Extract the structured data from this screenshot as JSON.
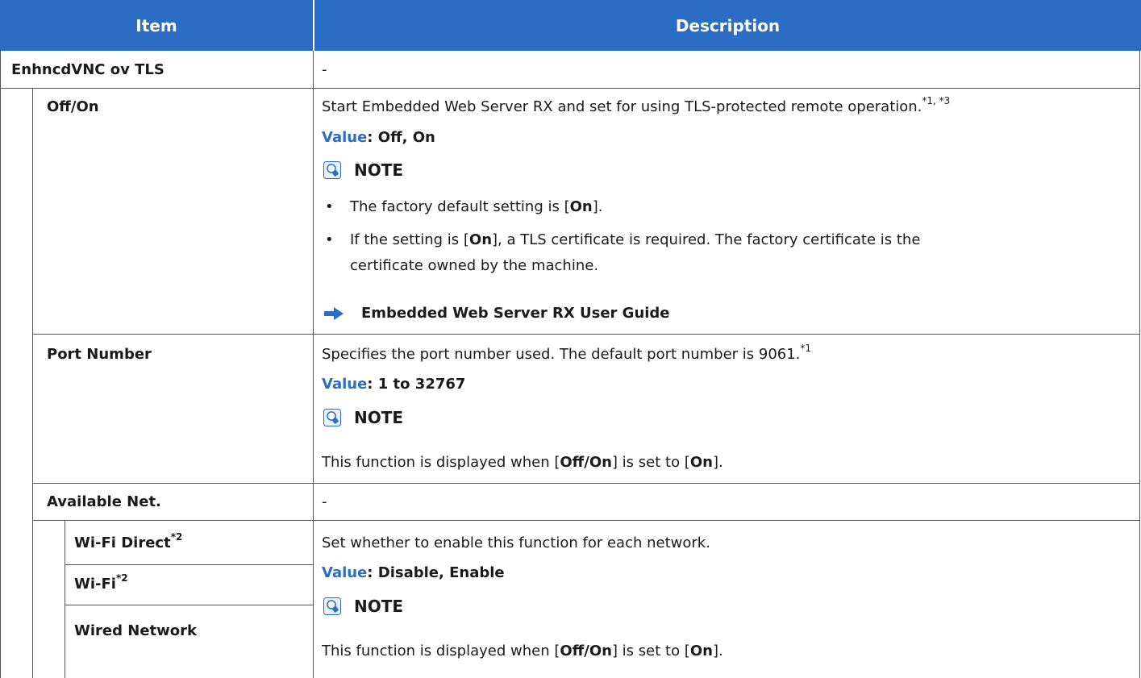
{
  "header": {
    "item": "Item",
    "description": "Description"
  },
  "rows": {
    "enhncd": {
      "label": "EnhncdVNC ov TLS",
      "desc": "-"
    },
    "offon": {
      "label": "Off/On",
      "desc": "Start Embedded Web Server RX and set for using TLS-protected remote operation.",
      "desc_sup": "*1, *3",
      "value_label": "Value",
      "value_text": ": Off, On",
      "note": "NOTE",
      "bullet1_pre": "The factory default setting is [",
      "bullet1_bold": "On",
      "bullet1_post": "].",
      "bullet2_pre": "If the setting is [",
      "bullet2_bold": "On",
      "bullet2_post": "], a TLS certificate is required. The factory certificate is the",
      "bullet2_line2": "certificate owned by the machine.",
      "ref": "Embedded Web Server RX User Guide"
    },
    "port": {
      "label": "Port Number",
      "desc": "Specifies the port number used. The default port number is 9061.",
      "desc_sup": "*1",
      "value_label": "Value",
      "value_text": ": 1 to 32767",
      "note": "NOTE",
      "note_pre": "This function is displayed when [",
      "note_b1": "Off/On",
      "note_mid": "] is set to [",
      "note_b2": "On",
      "note_post": "]."
    },
    "avail": {
      "label": "Available Net.",
      "desc": "-"
    },
    "wifidirect": {
      "label": "Wi-Fi Direct",
      "sup": "*2"
    },
    "wifi": {
      "label": "Wi-Fi",
      "sup": "*2"
    },
    "wired": {
      "label": "Wired Network"
    },
    "network_desc": {
      "desc": "Set whether to enable this function for each network.",
      "value_label": "Value",
      "value_text": ": Disable, Enable",
      "note": "NOTE",
      "note_pre": "This function is displayed when [",
      "note_b1": "Off/On",
      "note_mid": "] is set to [",
      "note_b2": "On",
      "note_post": "]."
    }
  },
  "colors": {
    "header_bg": "#2b6cc4",
    "value_blue": "#2b6cc4",
    "grid": "#555555"
  },
  "icons": {
    "note": "lightbulb-note-icon",
    "ref": "right-arrow-icon"
  }
}
